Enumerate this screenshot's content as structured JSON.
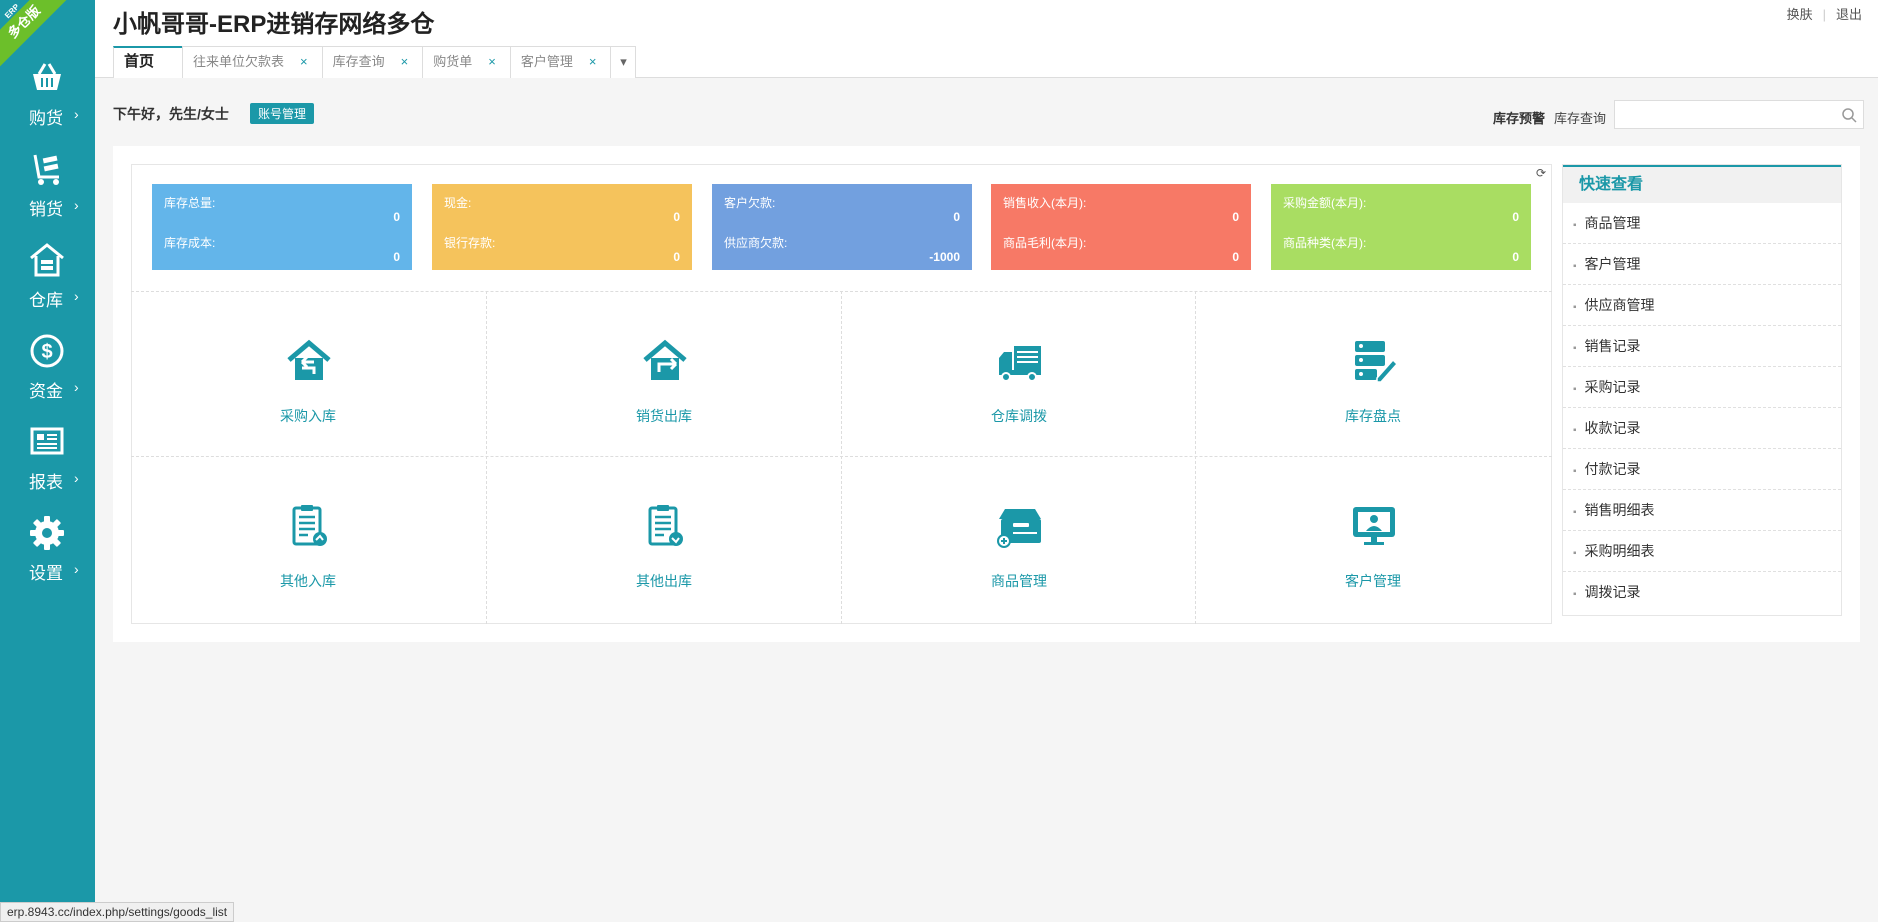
{
  "app": {
    "title": "小帆哥哥-ERP进销存网络多仓",
    "ribbon": "多仓版",
    "ribbon_small": "ERP"
  },
  "top_links": {
    "skin": "换肤",
    "logout": "退出"
  },
  "sidebar": {
    "items": [
      {
        "label": "购货",
        "icon": "basket-icon"
      },
      {
        "label": "销货",
        "icon": "cart-icon"
      },
      {
        "label": "仓库",
        "icon": "warehouse-icon"
      },
      {
        "label": "资金",
        "icon": "dollar-icon"
      },
      {
        "label": "报表",
        "icon": "report-icon"
      },
      {
        "label": "设置",
        "icon": "gear-icon"
      }
    ]
  },
  "tabs": [
    {
      "label": "首页",
      "active": true
    },
    {
      "label": "往来单位欠款表",
      "close": "×"
    },
    {
      "label": "库存查询",
      "close": "×"
    },
    {
      "label": "购货单",
      "close": "×"
    },
    {
      "label": "客户管理",
      "close": "×"
    }
  ],
  "greeting": {
    "text": "下午好，先生/女士",
    "account_button": "账号管理"
  },
  "inventory": {
    "alert_label": "库存预警",
    "query_label": "库存查询",
    "search_placeholder": ""
  },
  "stats": [
    {
      "label1": "库存总量:",
      "value1": "0",
      "label2": "库存成本:",
      "value2": "0",
      "color": "#63b5ea"
    },
    {
      "label1": "现金:",
      "value1": "0",
      "label2": "银行存款:",
      "value2": "0",
      "color": "#f5c35c"
    },
    {
      "label1": "客户欠款:",
      "value1": "0",
      "label2": "供应商欠款:",
      "value2": "-1000",
      "color": "#72a0df"
    },
    {
      "label1": "销售收入(本月):",
      "value1": "0",
      "label2": "商品毛利(本月):",
      "value2": "0",
      "color": "#f77966"
    },
    {
      "label1": "采购金额(本月):",
      "value1": "0",
      "label2": "商品种类(本月):",
      "value2": "0",
      "color": "#a9dd62"
    }
  ],
  "tiles": [
    {
      "label": "采购入库",
      "icon": "purchase-in-icon"
    },
    {
      "label": "销货出库",
      "icon": "sales-out-icon"
    },
    {
      "label": "仓库调拨",
      "icon": "truck-icon"
    },
    {
      "label": "库存盘点",
      "icon": "stock-check-icon"
    },
    {
      "label": "其他入库",
      "icon": "clipboard-in-icon"
    },
    {
      "label": "其他出库",
      "icon": "clipboard-out-icon"
    },
    {
      "label": "商品管理",
      "icon": "goods-box-icon"
    },
    {
      "label": "客户管理",
      "icon": "customer-monitor-icon"
    }
  ],
  "quick_view": {
    "title": "快速查看",
    "items": [
      "商品管理",
      "客户管理",
      "供应商管理",
      "销售记录",
      "采购记录",
      "收款记录",
      "付款记录",
      "销售明细表",
      "采购明细表",
      "调拨记录"
    ]
  },
  "status_url": "erp.8943.cc/index.php/settings/goods_list",
  "colors": {
    "accent": "#1b98a8",
    "ribbon": "#6cbf2a"
  }
}
